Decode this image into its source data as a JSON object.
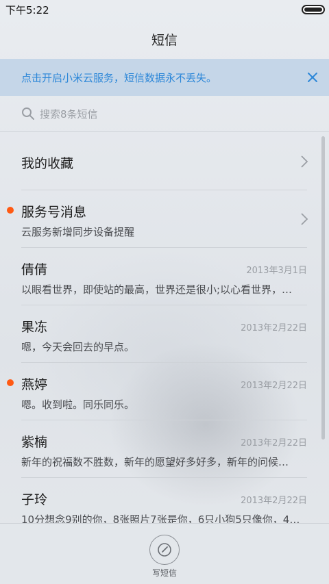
{
  "status": {
    "time": "下午5:22"
  },
  "header": {
    "title": "短信"
  },
  "banner": {
    "text": "点击开启小米云服务，短信数据永不丢失。"
  },
  "search": {
    "placeholder": "搜索8条短信"
  },
  "favorites": {
    "label": "我的收藏"
  },
  "conversations": [
    {
      "name": "服务号消息",
      "snippet": "云服务新增同步设备提醒",
      "date": "",
      "unread": true
    },
    {
      "name": "倩倩",
      "snippet": "以眼看世界，即使站的最高，世界还是很小;以心看世界，…",
      "date": "2013年3月1日",
      "unread": false
    },
    {
      "name": "果冻",
      "snippet": "嗯，今天会回去的早点。",
      "date": "2013年2月22日",
      "unread": false
    },
    {
      "name": "燕婷",
      "snippet": "嗯。收到啦。同乐同乐。",
      "date": "2013年2月22日",
      "unread": true
    },
    {
      "name": "紫楠",
      "snippet": "新年的祝福数不胜数，新年的愿望好多好多，新年的问候…",
      "date": "2013年2月22日",
      "unread": false
    },
    {
      "name": "子玲",
      "snippet": "10分想念9别的你，8张照片7张是你，6只小狗5只像你，4…",
      "date": "2013年2月22日",
      "unread": false
    }
  ],
  "compose": {
    "label": "写短信"
  },
  "colors": {
    "accent": "#2b86d8",
    "unread_dot": "#ff5a13",
    "banner_bg": "#c5d6e8"
  }
}
